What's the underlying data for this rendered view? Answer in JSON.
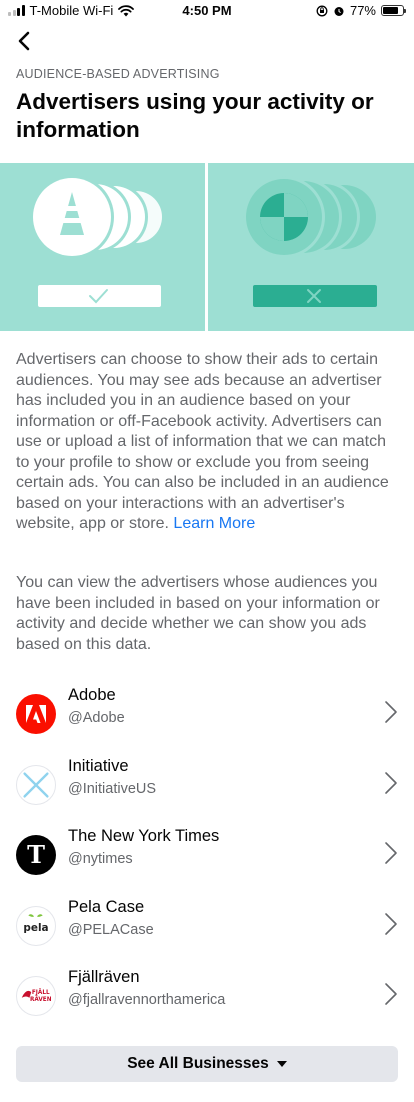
{
  "status_bar": {
    "carrier": "T-Mobile Wi-Fi",
    "time": "4:50 PM",
    "battery": "77%",
    "battery_fraction": 0.77
  },
  "header": {
    "back_icon": "chevron-left-icon",
    "eyebrow": "AUDIENCE-BASED ADVERTISING",
    "title": "Advertisers using your activity or information"
  },
  "illustration": {
    "background": "#9ddfd3",
    "accent": "#2bae92",
    "left_icon": "checkmark-icon",
    "right_icon": "x-icon"
  },
  "body": {
    "paragraph1": "Advertisers can choose to show their ads to certain audiences. You may see ads because an advertiser has included you in an audience based on your information or off-Facebook activity. Advertisers can use or upload a list of information that we can match to your profile to show or exclude you from seeing certain ads. You can also be included in an audience based on your interactions with an advertiser's website, app or store.",
    "learn_more": "Learn More",
    "paragraph2": "You can view the advertisers whose audiences you have been included in based on your information or activity and decide whether we can show you ads based on this data."
  },
  "businesses": [
    {
      "name": "Adobe",
      "handle": "@Adobe"
    },
    {
      "name": "Initiative",
      "handle": "@InitiativeUS"
    },
    {
      "name": "The New York Times",
      "handle": "@nytimes"
    },
    {
      "name": "Pela Case",
      "handle": "@PELACase"
    },
    {
      "name": "Fjällräven",
      "handle": "@fjallravennorthamerica"
    }
  ],
  "logos": {
    "pela": "pela",
    "fjallraven_line1": "FJÄLL",
    "fjallraven_line2": "RÄVEN"
  },
  "see_all": {
    "label": "See All Businesses",
    "icon": "caret-down-icon"
  },
  "colors": {
    "link": "#1877f2",
    "adobe_red": "#fa0f00",
    "fjallraven_red": "#c8102e",
    "button_bg": "#e4e6eb"
  }
}
